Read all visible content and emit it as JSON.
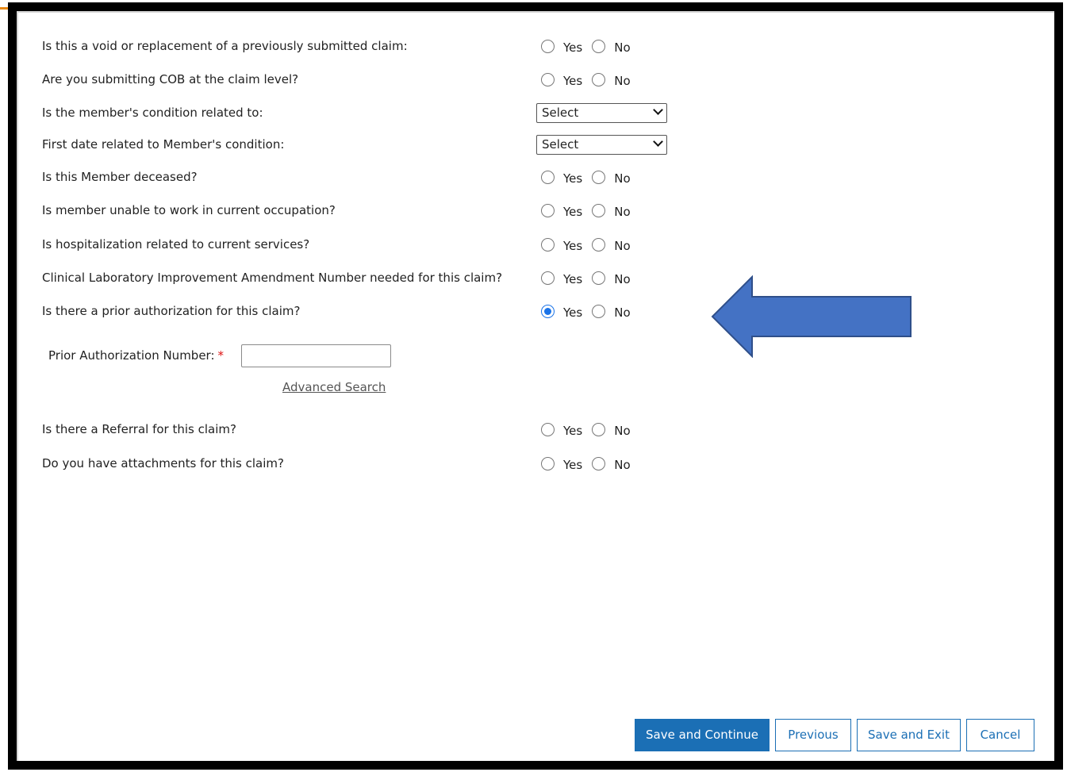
{
  "questions": [
    {
      "label": "Is this a void or replacement of a previously submitted claim:",
      "type": "radio",
      "selected": null
    },
    {
      "label": "Are you submitting COB at the claim level?",
      "type": "radio",
      "selected": null
    },
    {
      "label": "Is the member's condition related to:",
      "type": "select",
      "value": "Select"
    },
    {
      "label": "First date related to Member's condition:",
      "type": "select",
      "value": "Select"
    },
    {
      "label": "Is this Member deceased?",
      "type": "radio",
      "selected": null
    },
    {
      "label": "Is member unable to work in current occupation?",
      "type": "radio",
      "selected": null
    },
    {
      "label": "Is hospitalization related to current services?",
      "type": "radio",
      "selected": null
    },
    {
      "label": "Clinical Laboratory Improvement Amendment Number needed for this claim?",
      "type": "radio",
      "selected": null
    },
    {
      "label": "Is there a prior authorization for this claim?",
      "type": "radio",
      "selected": "Yes"
    },
    {
      "label": "Is there a Referral for this claim?",
      "type": "radio",
      "selected": null
    },
    {
      "label": "Do you have attachments for this claim?",
      "type": "radio",
      "selected": null
    }
  ],
  "radio_options": {
    "yes": "Yes",
    "no": "No"
  },
  "prior_auth": {
    "label": "Prior Authorization Number:",
    "required_marker": "*",
    "value": "",
    "advanced_search": "Advanced Search"
  },
  "buttons": {
    "save_continue": "Save and Continue",
    "previous": "Previous",
    "save_exit": "Save and Exit",
    "cancel": "Cancel"
  },
  "colors": {
    "primary": "#1b6fb5",
    "arrow_fill": "#4472c4",
    "radio_selected": "#1a73e8",
    "required": "#dd1111"
  },
  "annotation": {
    "icon": "left-arrow-icon"
  }
}
